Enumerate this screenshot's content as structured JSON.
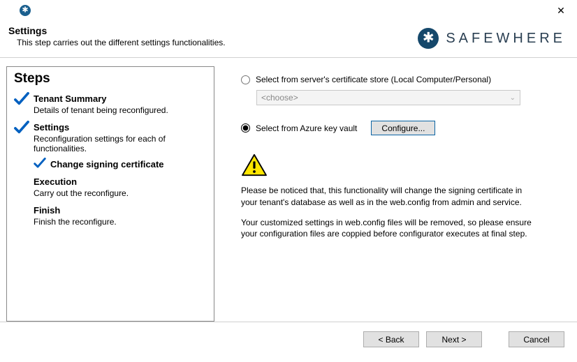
{
  "header": {
    "title": "Settings",
    "subtitle": "This step carries out the different settings functionalities.",
    "brand": "SAFEWHERE"
  },
  "steps": {
    "heading": "Steps",
    "items": [
      {
        "label": "Tenant Summary",
        "desc": "Details of tenant being reconfigured."
      },
      {
        "label": "Settings",
        "desc": "Reconfiguration settings for each of functionalities.",
        "sub": {
          "label": "Change signing certificate"
        }
      },
      {
        "label": "Execution",
        "desc": "Carry out the reconfigure."
      },
      {
        "label": "Finish",
        "desc": "Finish the reconfigure."
      }
    ]
  },
  "options": {
    "cert_store": {
      "label": "Select from server's certificate store (Local Computer/Personal)",
      "placeholder": "<choose>"
    },
    "azure": {
      "label": "Select from Azure key vault",
      "button": "Configure..."
    }
  },
  "warning": {
    "p1": "Please be noticed that, this functionality will change the signing certificate in your tenant's database as well as in the web.config from admin and service.",
    "p2": "Your customized settings in web.config files will be removed, so please ensure your configuration files are coppied before configurator executes at final step."
  },
  "footer": {
    "back": "< Back",
    "next": "Next >",
    "cancel": "Cancel"
  }
}
